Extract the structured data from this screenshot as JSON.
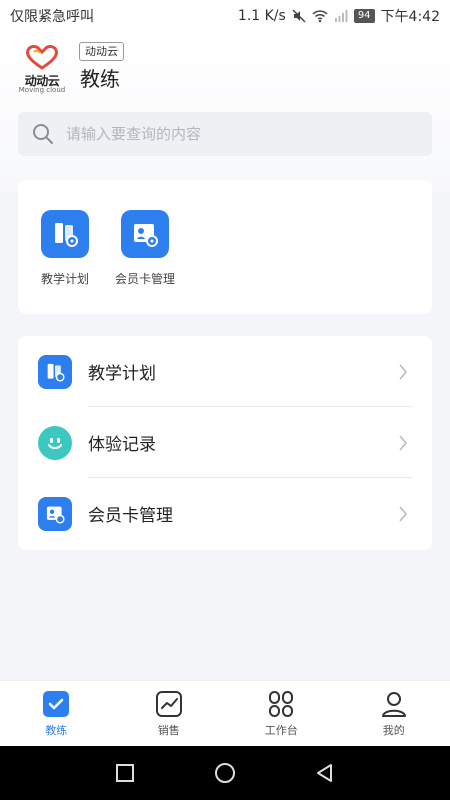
{
  "status_bar": {
    "carrier": "仅限紧急呼叫",
    "speed": "1.1 K/s",
    "battery": "94",
    "time": "下午4:42"
  },
  "header": {
    "logo_text": "动动云",
    "logo_sub": "Moving cloud",
    "brand_tag": "动动云",
    "title": "教练"
  },
  "search": {
    "placeholder": "请输入要查询的内容",
    "icon": "search-icon"
  },
  "quick_actions": [
    {
      "label": "教学计划",
      "icon": "teaching-plan-icon"
    },
    {
      "label": "会员卡管理",
      "icon": "member-card-icon"
    }
  ],
  "menu_list": [
    {
      "label": "教学计划",
      "icon": "teaching-plan-icon"
    },
    {
      "label": "体验记录",
      "icon": "smiley-icon"
    },
    {
      "label": "会员卡管理",
      "icon": "member-card-icon"
    }
  ],
  "bottom_nav": [
    {
      "label": "教练",
      "icon": "check-icon",
      "active": true
    },
    {
      "label": "销售",
      "icon": "chart-icon",
      "active": false
    },
    {
      "label": "工作台",
      "icon": "grid-icon",
      "active": false
    },
    {
      "label": "我的",
      "icon": "user-icon",
      "active": false
    }
  ],
  "colors": {
    "accent": "#2d7ff0",
    "teal": "#3cc8c0",
    "background": "#f4f5f9"
  }
}
